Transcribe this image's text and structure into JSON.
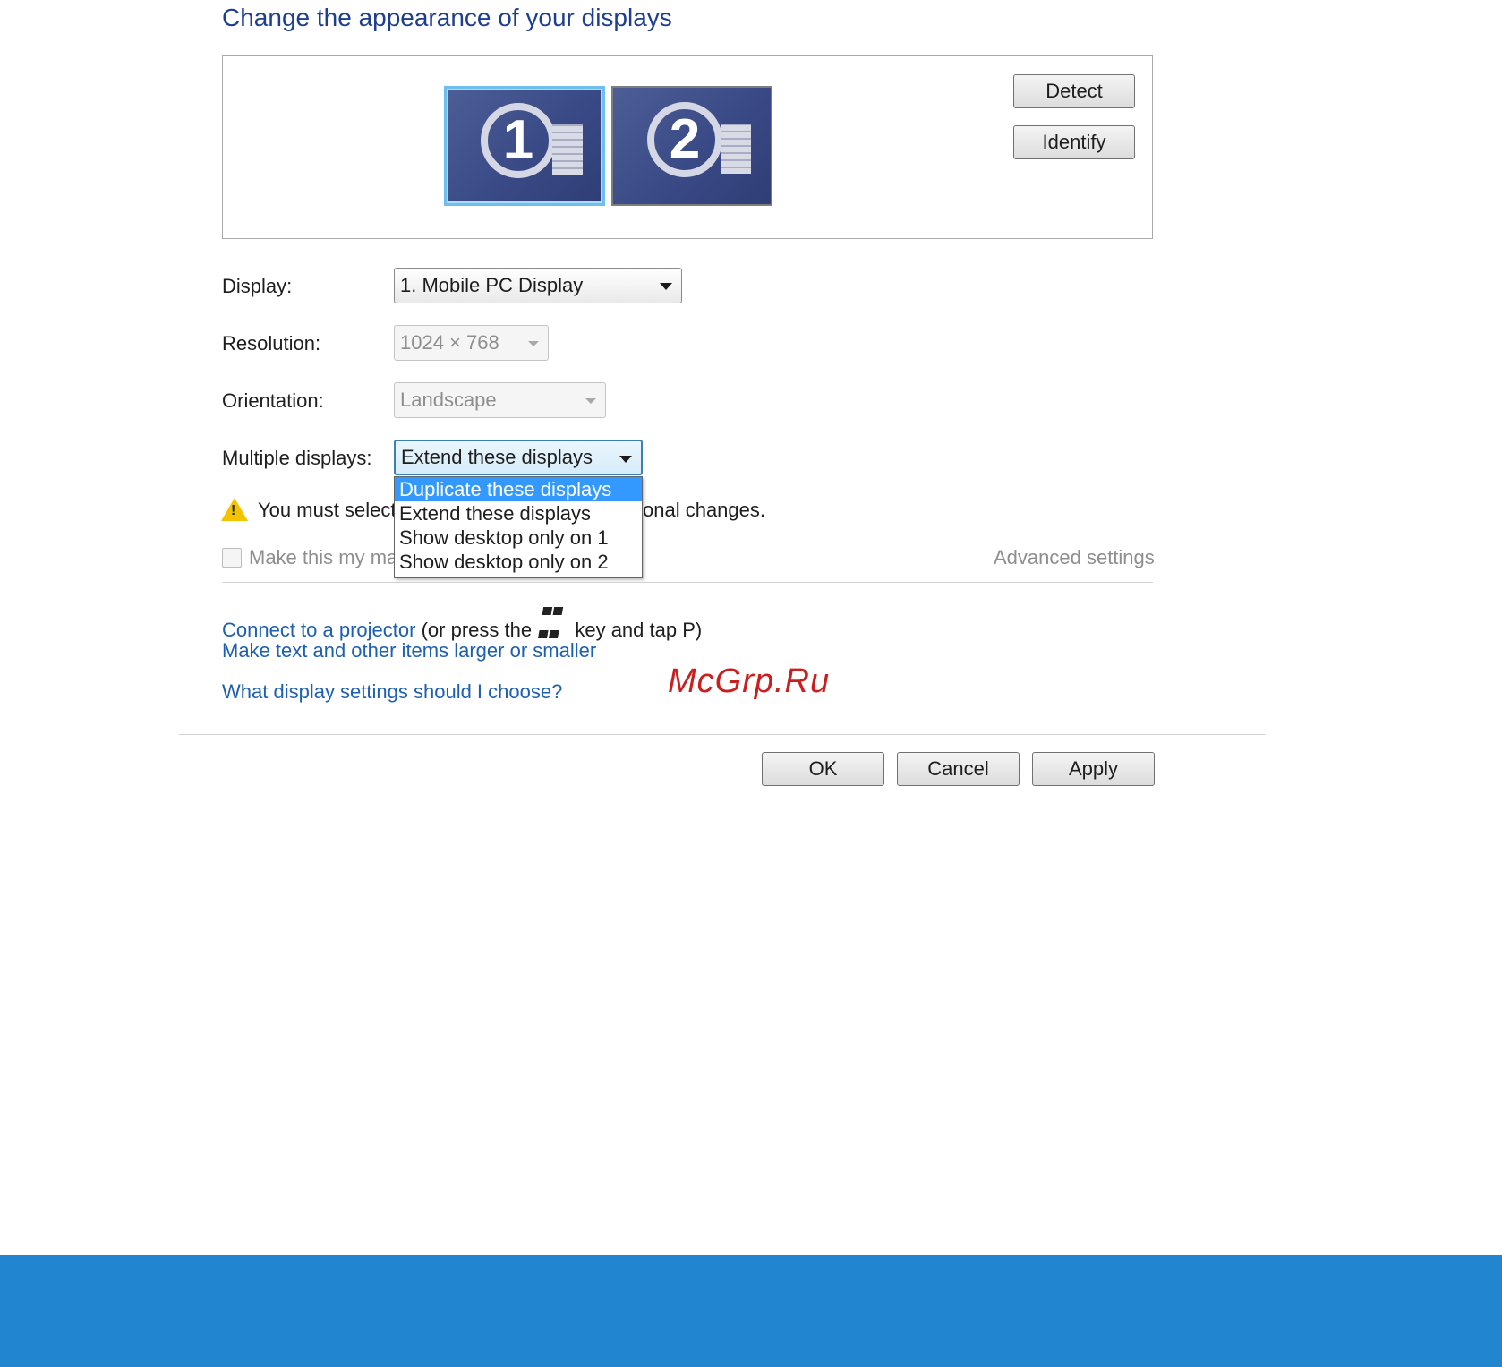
{
  "title": "Change the appearance of your displays",
  "monitors": [
    {
      "number": "1",
      "selected": true
    },
    {
      "number": "2",
      "selected": false
    }
  ],
  "buttons": {
    "detect": "Detect",
    "identify": "Identify",
    "ok": "OK",
    "cancel": "Cancel",
    "apply": "Apply"
  },
  "fields": {
    "display": {
      "label": "Display:",
      "value": "1. Mobile PC Display"
    },
    "resolution": {
      "label": "Resolution:",
      "value": "1024 × 768"
    },
    "orientation": {
      "label": "Orientation:",
      "value": "Landscape"
    },
    "multiple_displays": {
      "label": "Multiple displays:",
      "value": "Extend these displays",
      "options": [
        "Duplicate these displays",
        "Extend these displays",
        "Show desktop only on 1",
        "Show desktop only on 2"
      ],
      "highlighted_index": 0
    }
  },
  "warning": {
    "text_start": "You must select",
    "text_end": "onal changes."
  },
  "checkbox": {
    "label": "Make this my ma"
  },
  "advanced_settings": "Advanced settings",
  "links": {
    "projector": "Connect to a projector",
    "projector_suffix_1": "(or press the",
    "projector_suffix_2": "key and tap P)",
    "text_size": "Make text and other items larger or smaller",
    "help": "What display settings should I choose?"
  },
  "watermark": "McGrp.Ru",
  "colors": {
    "footer_band": "#2185d0",
    "link": "#1d5fb0",
    "title": "#1e3f8f",
    "highlight": "#3399ff"
  }
}
